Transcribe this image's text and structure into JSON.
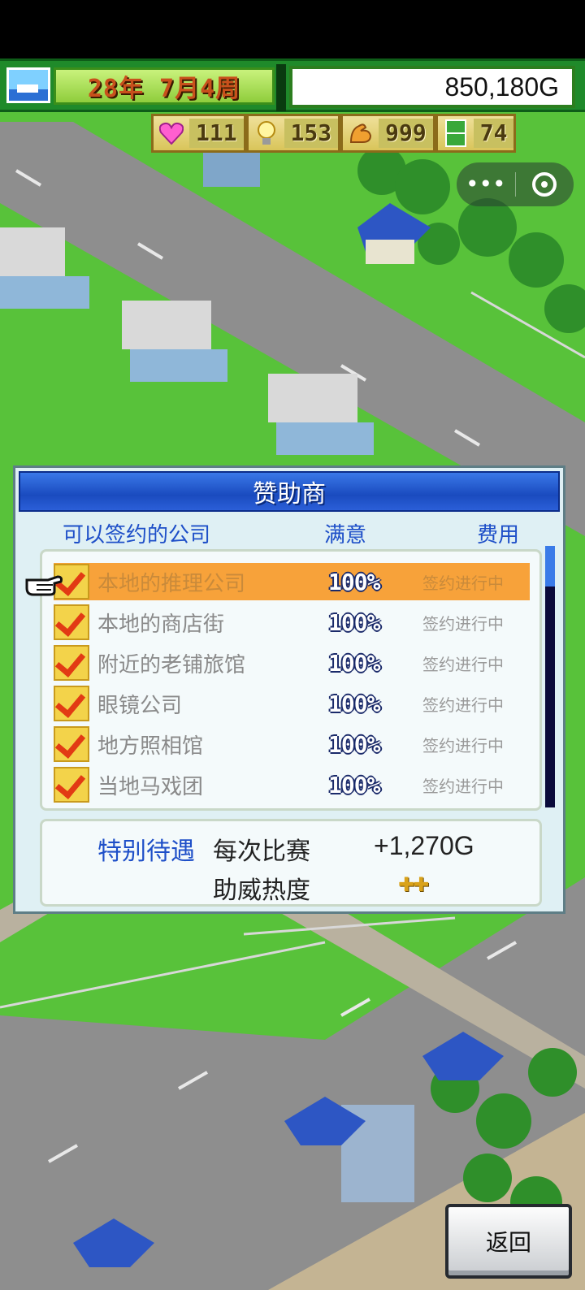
{
  "hud": {
    "date": "28年 7月4周",
    "money": "850,180G",
    "stats": [
      {
        "icon": "heart-icon",
        "value": "111"
      },
      {
        "icon": "lightbulb-icon",
        "value": "153"
      },
      {
        "icon": "muscle-icon",
        "value": "999"
      },
      {
        "icon": "field-icon",
        "value": "74"
      }
    ]
  },
  "capsule": {
    "menu_glyph": "•••"
  },
  "dialog": {
    "title": "赞助商",
    "col_company": "可以签约的公司",
    "col_satisfaction": "满意",
    "col_fee": "费用",
    "rows": [
      {
        "name": "本地的推理公司",
        "pct": "100%",
        "status": "签约进行中"
      },
      {
        "name": "本地的商店街",
        "pct": "100%",
        "status": "签约进行中"
      },
      {
        "name": "附近的老铺旅馆",
        "pct": "100%",
        "status": "签约进行中"
      },
      {
        "name": "眼镜公司",
        "pct": "100%",
        "status": "签约进行中"
      },
      {
        "name": "地方照相馆",
        "pct": "100%",
        "status": "签约进行中"
      },
      {
        "name": "当地马戏团",
        "pct": "100%",
        "status": "签约进行中"
      }
    ],
    "special_label": "特别待遇",
    "per_match_label": "每次比赛",
    "per_match_value": "+1,270G",
    "cheer_label": "助威热度",
    "cheer_value": "✚✚"
  },
  "back_button": "返回",
  "colors": {
    "hud_green": "#1f8a2a",
    "dialog_title_blue": "#1a4bbf",
    "selected_row": "#f7a23a",
    "check_red": "#e23a14"
  }
}
